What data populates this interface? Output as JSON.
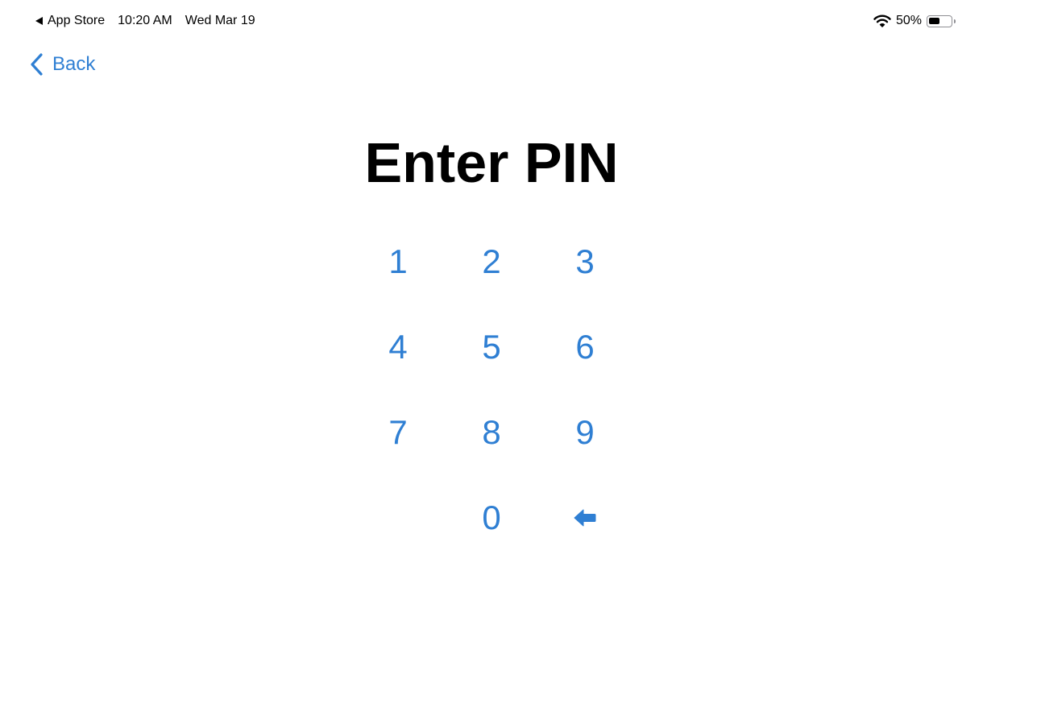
{
  "status_bar": {
    "back_app_label": "App Store",
    "time": "10:20 AM",
    "date": "Wed Mar 19",
    "battery_percent_label": "50%",
    "battery_level": 0.5,
    "icons": [
      "back-app-arrow-icon",
      "wifi-icon",
      "battery-icon"
    ]
  },
  "nav": {
    "back_label": "Back",
    "back_icon": "chevron-left-icon"
  },
  "title": "Enter PIN",
  "keypad": {
    "keys": [
      "1",
      "2",
      "3",
      "4",
      "5",
      "6",
      "7",
      "8",
      "9",
      "0"
    ],
    "backspace_icon": "backspace-icon"
  },
  "colors": {
    "accent": "#2f7fd3",
    "text": "#000000",
    "background": "#ffffff"
  }
}
